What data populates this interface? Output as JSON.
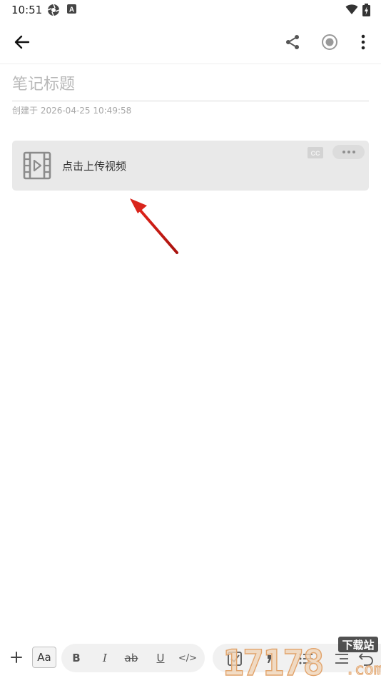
{
  "status_bar": {
    "time": "10:51",
    "icons": [
      "camera-aperture-icon",
      "a-badge-icon",
      "wifi-icon",
      "battery-charging-icon"
    ]
  },
  "app_bar": {
    "back_icon": "arrow-left-icon",
    "actions": [
      "share-icon",
      "record-icon",
      "more-vertical-icon"
    ]
  },
  "note": {
    "title_placeholder": "笔记标题",
    "title_value": "",
    "created_label": "创建于 2026-04-25 10:49:58"
  },
  "video_card": {
    "label": "点击上传视频",
    "icon": "film-icon",
    "cc_icon": "closed-caption-icon",
    "more_icon": "more-horizontal-icon"
  },
  "annotation": {
    "color": "#d9251c"
  },
  "toolbar": {
    "add_label": "+",
    "font_label": "Aa",
    "bold_label": "B",
    "italic_label": "I",
    "strike_label": "ab",
    "underline_label": "U",
    "code_label": "</>",
    "icons": [
      "checkbox-icon",
      "quote-icon",
      "list-icon",
      "indent-icon",
      "undo-icon"
    ]
  },
  "watermark": {
    "text": "17178",
    "sub_text": "下载站",
    "domain_text": ".com"
  },
  "colors": {
    "accent": "#8b8b8b",
    "card_bg": "#e9e9e9",
    "arrow": "#d9251c"
  }
}
